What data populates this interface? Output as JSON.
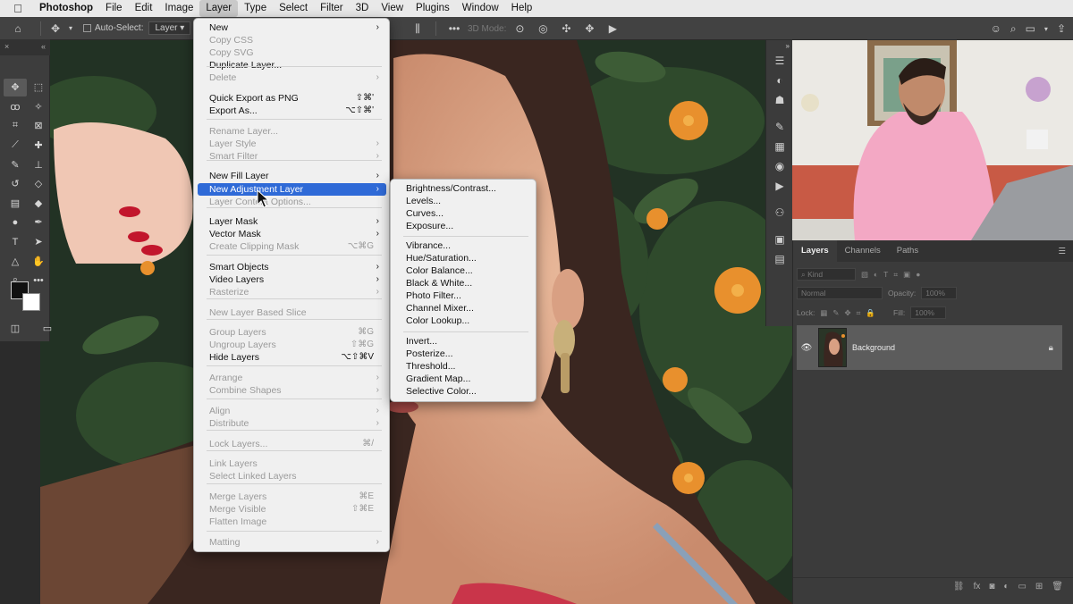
{
  "menubar": {
    "app": "Photoshop",
    "items": [
      "File",
      "Edit",
      "Image",
      "Layer",
      "Type",
      "Select",
      "Filter",
      "3D",
      "View",
      "Plugins",
      "Window",
      "Help"
    ],
    "active": "Layer"
  },
  "options_bar": {
    "auto_select_label": "Auto-Select:",
    "auto_select_value": "Layer",
    "mode_3d_label": "3D Mode:"
  },
  "layer_menu": {
    "items": [
      {
        "label": "New",
        "shortcut": "",
        "arrow": true,
        "disabled": false
      },
      {
        "label": "Copy CSS",
        "shortcut": "",
        "arrow": false,
        "disabled": true
      },
      {
        "label": "Copy SVG",
        "shortcut": "",
        "arrow": false,
        "disabled": true
      },
      {
        "label": "Duplicate Layer...",
        "shortcut": "",
        "arrow": false,
        "disabled": false
      },
      {
        "label": "Delete",
        "shortcut": "",
        "arrow": true,
        "disabled": true
      },
      {
        "label": "Quick Export as PNG",
        "shortcut": "⇧⌘'",
        "arrow": false,
        "disabled": false
      },
      {
        "label": "Export As...",
        "shortcut": "⌥⇧⌘'",
        "arrow": false,
        "disabled": false
      },
      {
        "label": "Rename Layer...",
        "shortcut": "",
        "arrow": false,
        "disabled": true
      },
      {
        "label": "Layer Style",
        "shortcut": "",
        "arrow": true,
        "disabled": true
      },
      {
        "label": "Smart Filter",
        "shortcut": "",
        "arrow": true,
        "disabled": true
      },
      {
        "label": "New Fill Layer",
        "shortcut": "",
        "arrow": true,
        "disabled": false
      },
      {
        "label": "New Adjustment Layer",
        "shortcut": "",
        "arrow": true,
        "disabled": false,
        "highlighted": true
      },
      {
        "label": "Layer Content Options...",
        "shortcut": "",
        "arrow": false,
        "disabled": true
      },
      {
        "label": "Layer Mask",
        "shortcut": "",
        "arrow": true,
        "disabled": false
      },
      {
        "label": "Vector Mask",
        "shortcut": "",
        "arrow": true,
        "disabled": false
      },
      {
        "label": "Create Clipping Mask",
        "shortcut": "⌥⌘G",
        "arrow": false,
        "disabled": true
      },
      {
        "label": "Smart Objects",
        "shortcut": "",
        "arrow": true,
        "disabled": false
      },
      {
        "label": "Video Layers",
        "shortcut": "",
        "arrow": true,
        "disabled": false
      },
      {
        "label": "Rasterize",
        "shortcut": "",
        "arrow": true,
        "disabled": true
      },
      {
        "label": "New Layer Based Slice",
        "shortcut": "",
        "arrow": false,
        "disabled": true
      },
      {
        "label": "Group Layers",
        "shortcut": "⌘G",
        "arrow": false,
        "disabled": true
      },
      {
        "label": "Ungroup Layers",
        "shortcut": "⇧⌘G",
        "arrow": false,
        "disabled": true
      },
      {
        "label": "Hide Layers",
        "shortcut": "⌥⇧⌘V",
        "arrow": false,
        "disabled": false
      },
      {
        "label": "Arrange",
        "shortcut": "",
        "arrow": true,
        "disabled": true
      },
      {
        "label": "Combine Shapes",
        "shortcut": "",
        "arrow": true,
        "disabled": true
      },
      {
        "label": "Align",
        "shortcut": "",
        "arrow": true,
        "disabled": true
      },
      {
        "label": "Distribute",
        "shortcut": "",
        "arrow": true,
        "disabled": true
      },
      {
        "label": "Lock Layers...",
        "shortcut": "⌘/",
        "arrow": false,
        "disabled": true
      },
      {
        "label": "Link Layers",
        "shortcut": "",
        "arrow": false,
        "disabled": true
      },
      {
        "label": "Select Linked Layers",
        "shortcut": "",
        "arrow": false,
        "disabled": true
      },
      {
        "label": "Merge Layers",
        "shortcut": "⌘E",
        "arrow": false,
        "disabled": true
      },
      {
        "label": "Merge Visible",
        "shortcut": "⇧⌘E",
        "arrow": false,
        "disabled": true
      },
      {
        "label": "Flatten Image",
        "shortcut": "",
        "arrow": false,
        "disabled": true
      },
      {
        "label": "Matting",
        "shortcut": "",
        "arrow": true,
        "disabled": true
      }
    ]
  },
  "adjustment_submenu": {
    "items": [
      "Brightness/Contrast...",
      "Levels...",
      "Curves...",
      "Exposure...",
      "Vibrance...",
      "Hue/Saturation...",
      "Color Balance...",
      "Black & White...",
      "Photo Filter...",
      "Channel Mixer...",
      "Color Lookup...",
      "Invert...",
      "Posterize...",
      "Threshold...",
      "Gradient Map...",
      "Selective Color..."
    ]
  },
  "layers_panel": {
    "tabs": [
      "Layers",
      "Channels",
      "Paths"
    ],
    "active_tab": "Layers",
    "kind_placeholder": "Kind",
    "blend_mode": "Normal",
    "opacity_label": "Opacity:",
    "opacity_value": "100%",
    "lock_label": "Lock:",
    "fill_label": "Fill:",
    "fill_value": "100%",
    "layers": [
      {
        "name": "Background",
        "visible": true,
        "locked": true
      }
    ]
  },
  "colors": {
    "menu_highlight": "#2f6ad7",
    "foreground_color": "#111111",
    "background_color": "#ffffff"
  }
}
